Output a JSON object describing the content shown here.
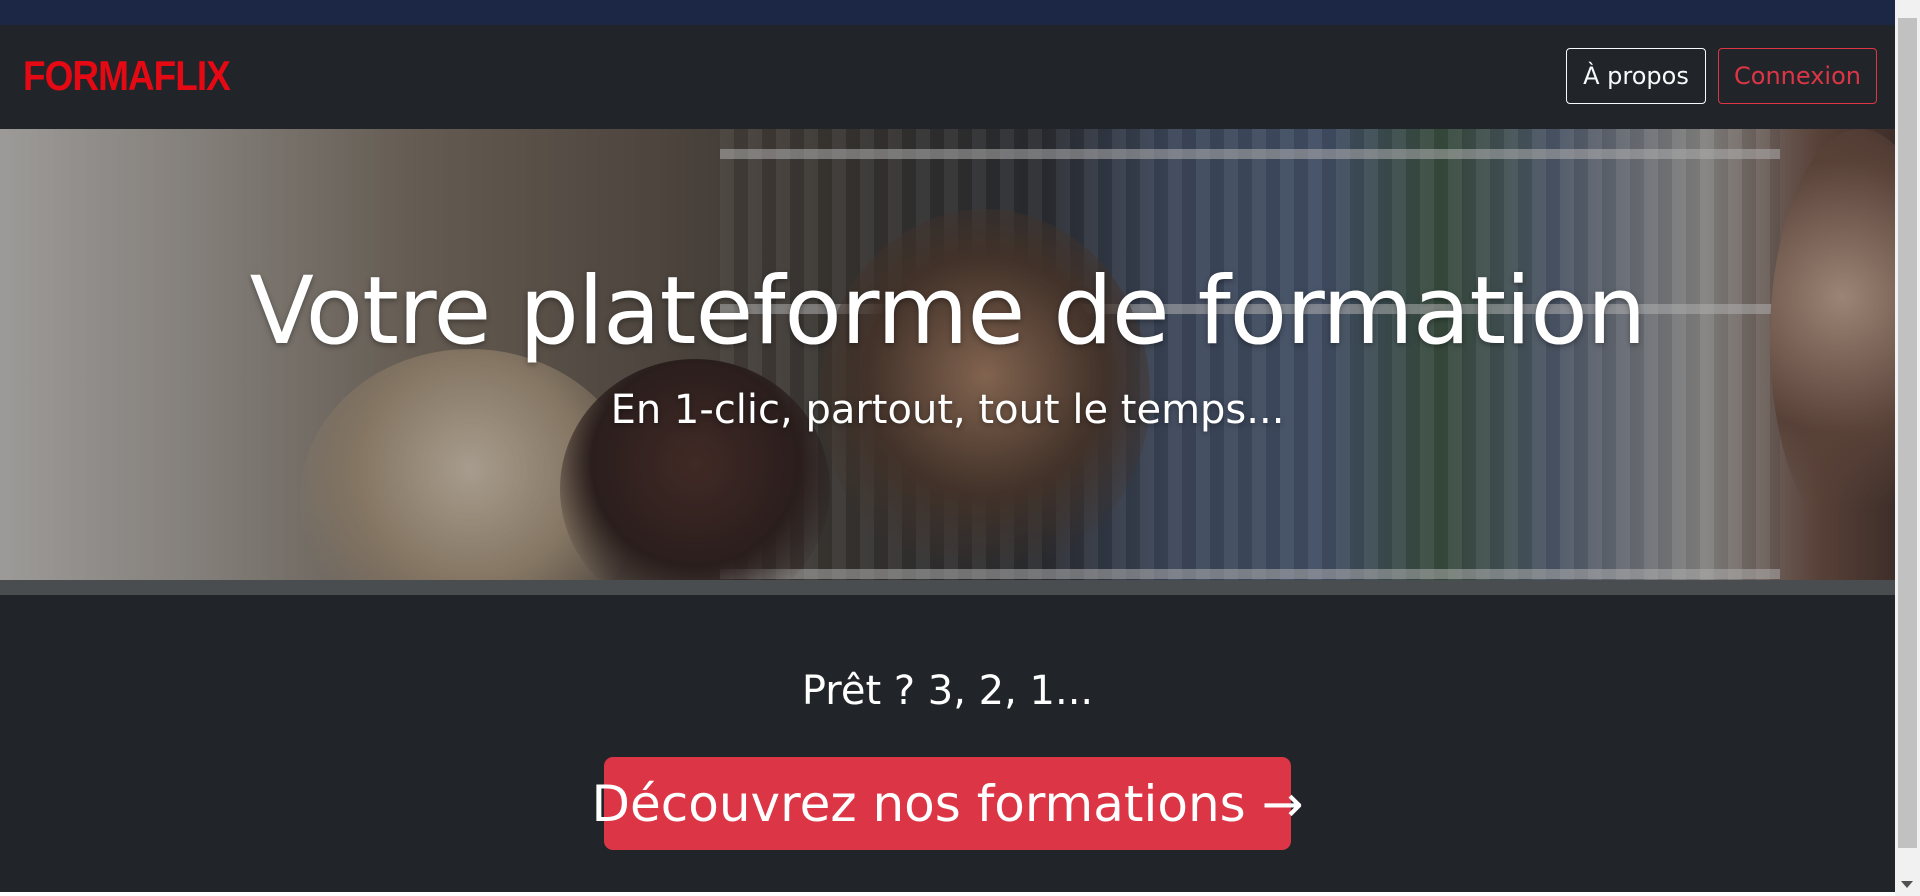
{
  "header": {
    "logo_text": "FORMAFLIX",
    "about_label": "À propos",
    "login_label": "Connexion"
  },
  "hero": {
    "title": "Votre plateforme de formation",
    "subtitle": "En 1-clic, partout, tout le temps..."
  },
  "cta": {
    "heading": "Prêt ? 3, 2, 1...",
    "button_label": "Découvrez nos formations →"
  },
  "colors": {
    "brand_red": "#e50914",
    "danger": "#dc3545",
    "navbar_bg": "#212529",
    "top_strip": "#1b2744"
  },
  "icons": {
    "scroll_down": "chevron-down-icon"
  }
}
